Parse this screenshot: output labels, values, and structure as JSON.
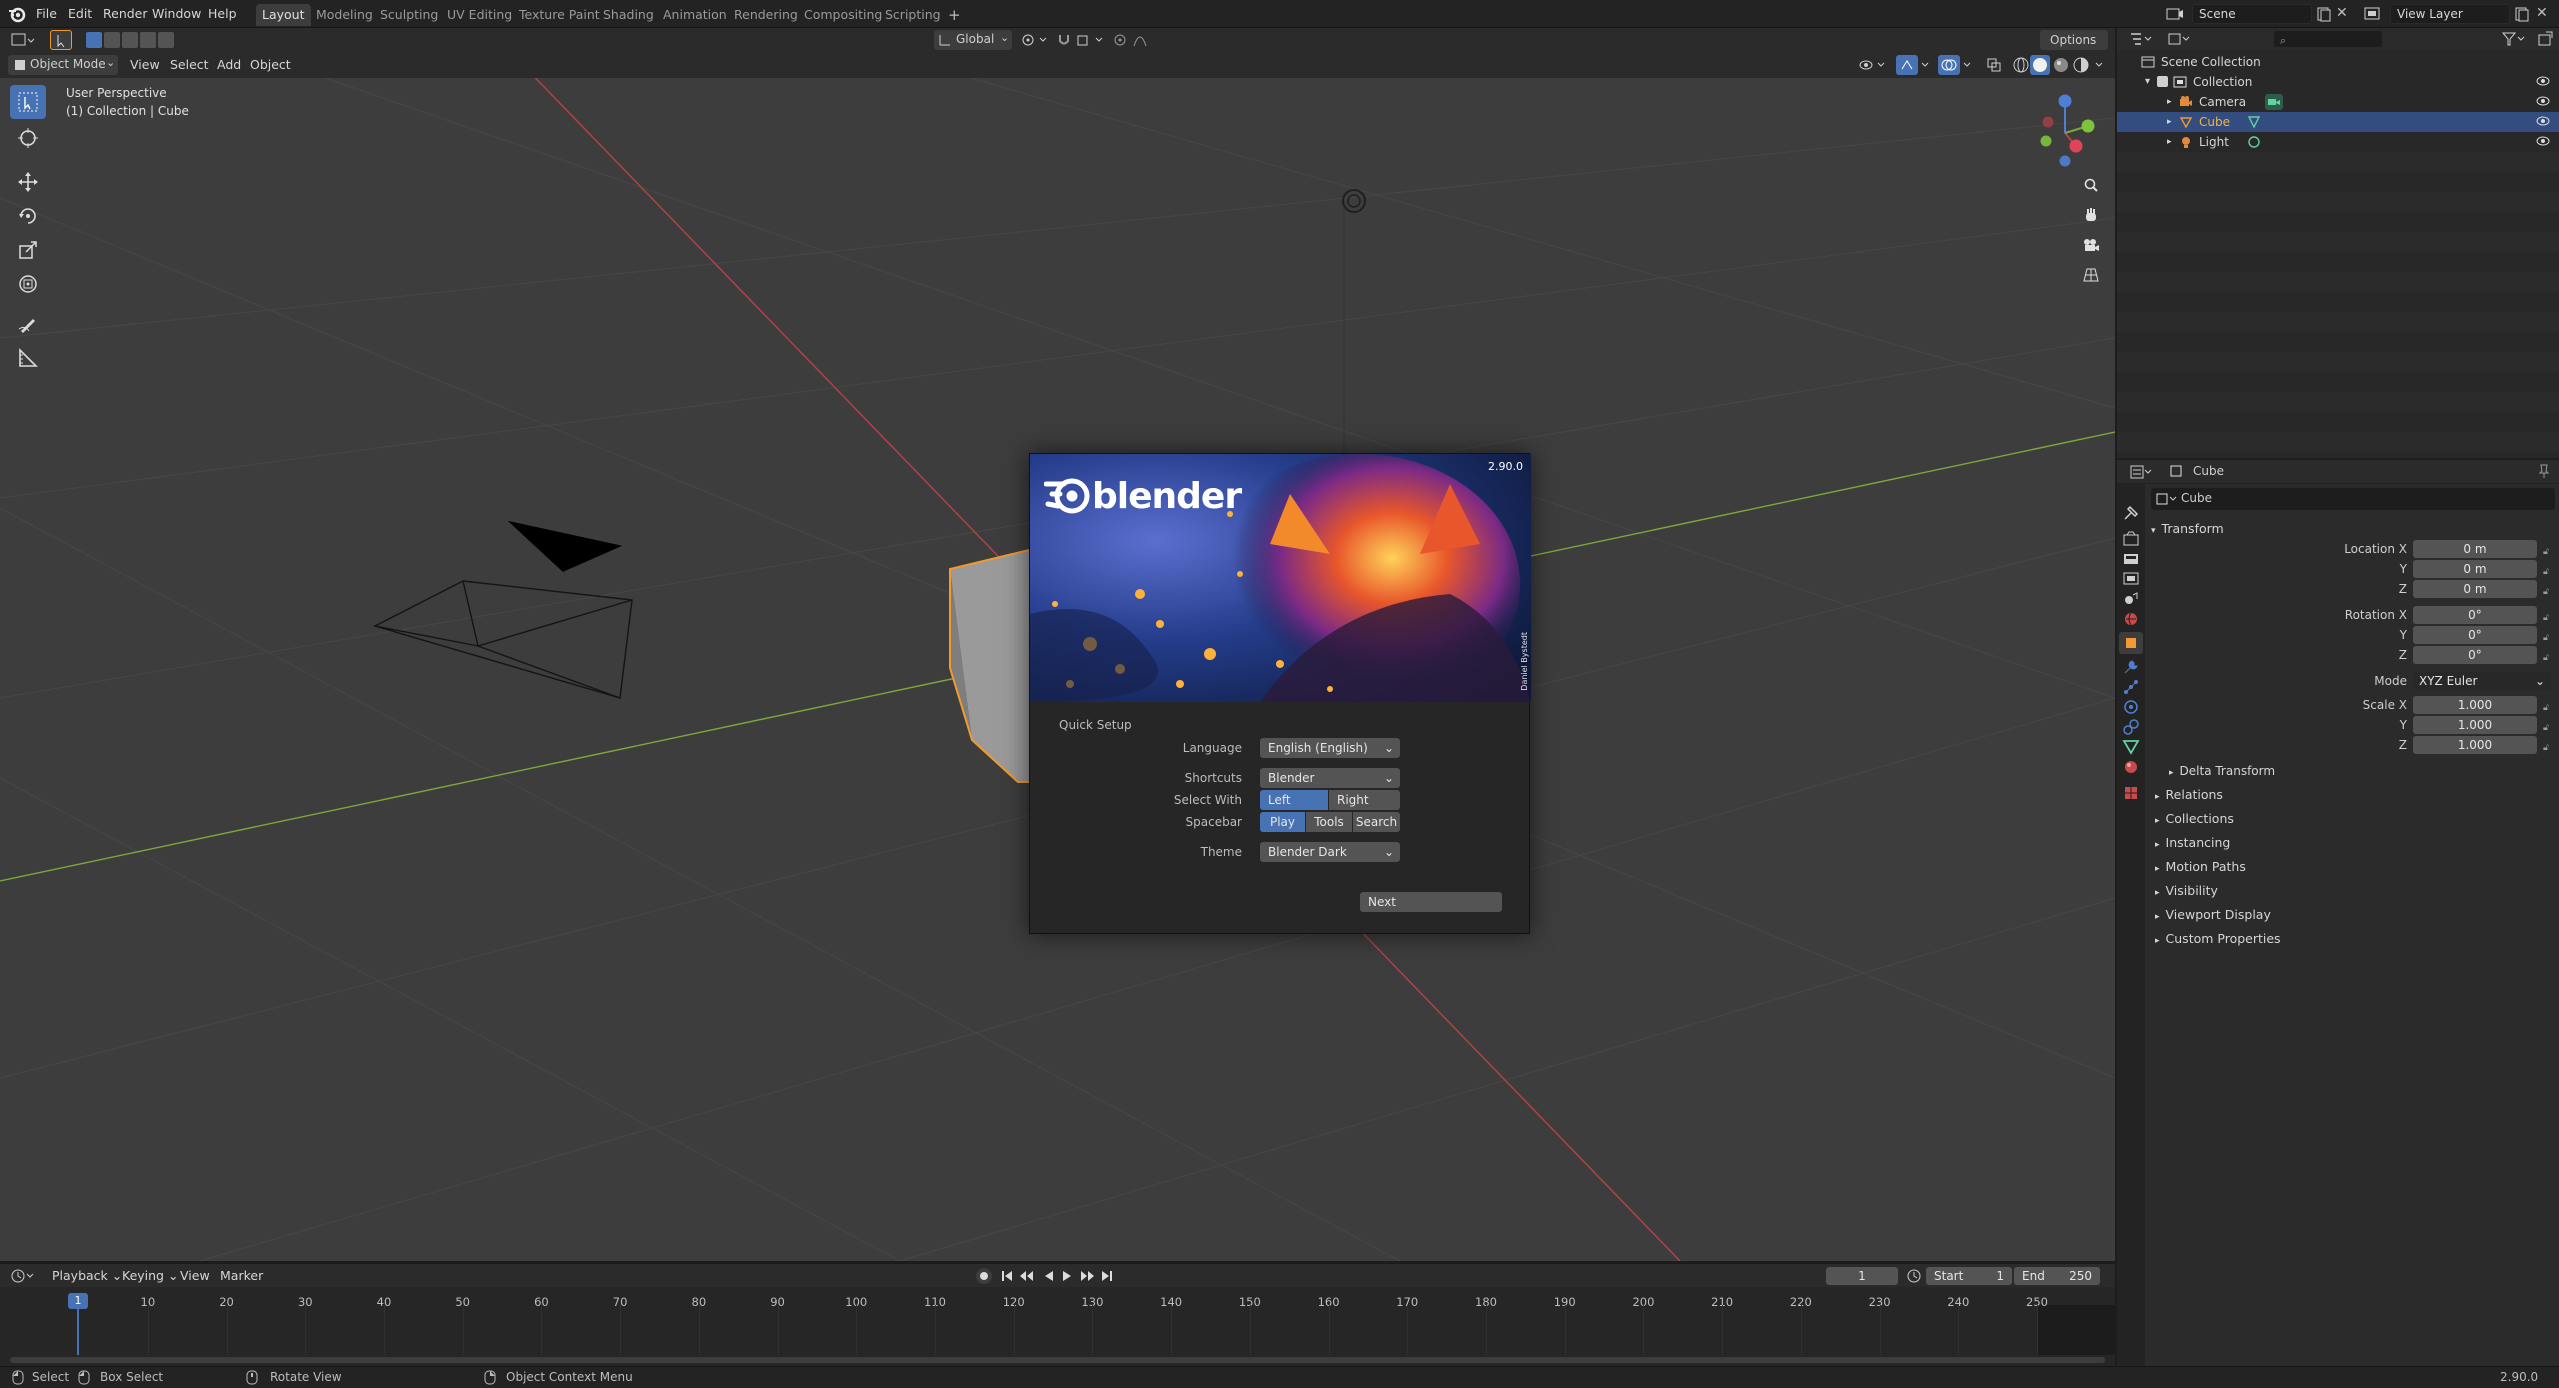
{
  "menu": {
    "items": [
      "File",
      "Edit",
      "Render",
      "Window",
      "Help"
    ]
  },
  "workspaces": [
    "Layout",
    "Modeling",
    "Sculpting",
    "UV Editing",
    "Texture Paint",
    "Shading",
    "Animation",
    "Rendering",
    "Compositing",
    "Scripting"
  ],
  "top_right": {
    "scene": "Scene",
    "view_layer": "View Layer"
  },
  "viewport_header": {
    "mode": "Object Mode",
    "menus": [
      "View",
      "Select",
      "Add",
      "Object"
    ],
    "transform_orientation": "Global",
    "options": "Options"
  },
  "viewport": {
    "overlay_line1": "User Perspective",
    "overlay_line2": "(1) Collection | Cube",
    "colors": {
      "background": "#3d3d3d",
      "x_axis": "#b8404a",
      "y_axis": "#7da83c",
      "selection": "#f29a2f"
    }
  },
  "splash": {
    "version": "2.90.0",
    "logo_text": "blender",
    "credit": "Daniel Bystedt",
    "quick_setup": "Quick Setup",
    "labels": {
      "language": "Language",
      "shortcuts": "Shortcuts",
      "select_with": "Select With",
      "spacebar": "Spacebar",
      "theme": "Theme"
    },
    "language_value": "English (English)",
    "shortcuts_value": "Blender",
    "select_options": [
      "Left",
      "Right"
    ],
    "select_active": "Left",
    "spacebar_options": [
      "Play",
      "Tools",
      "Search"
    ],
    "spacebar_active": "Play",
    "theme_value": "Blender Dark",
    "next_label": "Next"
  },
  "outliner": {
    "root": "Scene Collection",
    "collection": "Collection",
    "items": [
      {
        "name": "Camera",
        "selected": false
      },
      {
        "name": "Cube",
        "selected": true
      },
      {
        "name": "Light",
        "selected": false
      }
    ]
  },
  "properties": {
    "object_name_header": "Cube",
    "object_name_field": "Cube",
    "transform_label": "Transform",
    "location": {
      "label_x": "Location X",
      "label_y": "Y",
      "label_z": "Z",
      "x": "0 m",
      "y": "0 m",
      "z": "0 m"
    },
    "rotation": {
      "label_x": "Rotation X",
      "label_y": "Y",
      "label_z": "Z",
      "x": "0°",
      "y": "0°",
      "z": "0°"
    },
    "mode": {
      "label": "Mode",
      "value": "XYZ Euler"
    },
    "scale": {
      "label_x": "Scale X",
      "label_y": "Y",
      "label_z": "Z",
      "x": "1.000",
      "y": "1.000",
      "z": "1.000"
    },
    "delta_transform": "Delta Transform",
    "panels": [
      "Relations",
      "Collections",
      "Instancing",
      "Motion Paths",
      "Visibility",
      "Viewport Display",
      "Custom Properties"
    ]
  },
  "timeline": {
    "menus": [
      "Playback",
      "Keying",
      "View",
      "Marker"
    ],
    "current_frame": "1",
    "start_label": "Start",
    "start_value": "1",
    "end_label": "End",
    "end_value": "250",
    "playhead": "1",
    "ticks": [
      "10",
      "20",
      "30",
      "40",
      "50",
      "60",
      "70",
      "80",
      "90",
      "100",
      "110",
      "120",
      "130",
      "140",
      "150",
      "160",
      "170",
      "180",
      "190",
      "200",
      "210",
      "220",
      "230",
      "240",
      "250"
    ]
  },
  "statusbar": {
    "select": "Select",
    "box_select": "Box Select",
    "rotate_view": "Rotate View",
    "context_menu": "Object Context Menu",
    "version": "2.90.0"
  }
}
